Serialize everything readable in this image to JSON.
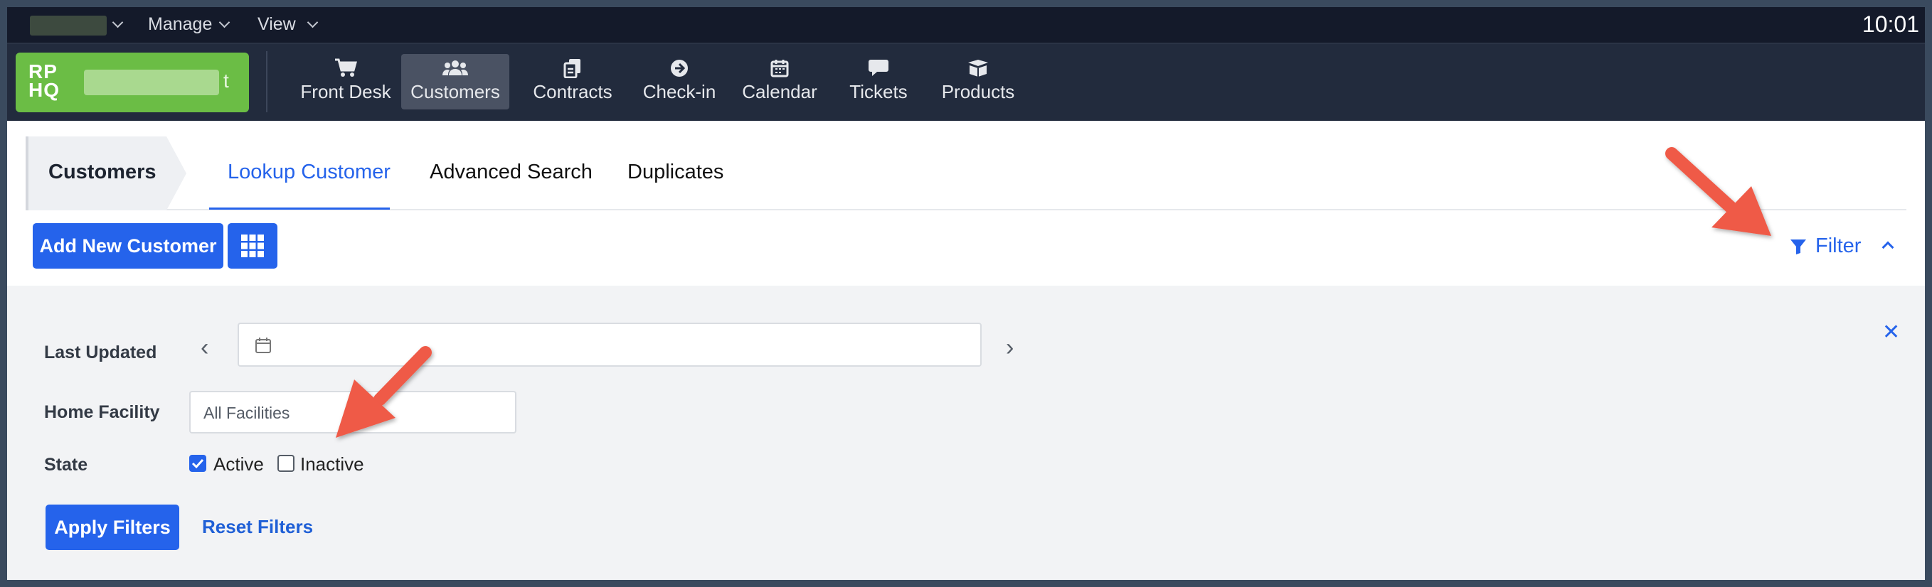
{
  "menubar": {
    "items": [
      {
        "label": "Manage"
      },
      {
        "label": "View"
      }
    ],
    "clock": "10:01"
  },
  "logo": {
    "mark_line1": "RP",
    "mark_line2": "HQ",
    "name_suffix": "t"
  },
  "mainnav": {
    "items": [
      {
        "label": "Front Desk",
        "icon": "cart-icon"
      },
      {
        "label": "Customers",
        "icon": "users-icon",
        "active": true
      },
      {
        "label": "Contracts",
        "icon": "documents-icon"
      },
      {
        "label": "Check-in",
        "icon": "arrow-circle-icon"
      },
      {
        "label": "Calendar",
        "icon": "calendar-icon"
      },
      {
        "label": "Tickets",
        "icon": "chat-icon"
      },
      {
        "label": "Products",
        "icon": "box-icon"
      }
    ]
  },
  "breadcrumb": "Customers",
  "tabs": [
    {
      "label": "Lookup Customer",
      "active": true
    },
    {
      "label": "Advanced Search"
    },
    {
      "label": "Duplicates"
    }
  ],
  "toolbar": {
    "add_customer": "Add New Customer",
    "filter": "Filter"
  },
  "filters": {
    "last_updated_label": "Last Updated",
    "home_facility_label": "Home Facility",
    "home_facility_value": "All Facilities",
    "state_label": "State",
    "state_options": [
      {
        "label": "Active",
        "checked": true
      },
      {
        "label": "Inactive",
        "checked": false
      }
    ],
    "apply": "Apply Filters",
    "reset": "Reset Filters"
  },
  "colors": {
    "accent": "#2563eb",
    "nav_bg": "#222b3d",
    "logo_bg": "#6bbd45",
    "annotation_arrow": "#ef5a47"
  }
}
